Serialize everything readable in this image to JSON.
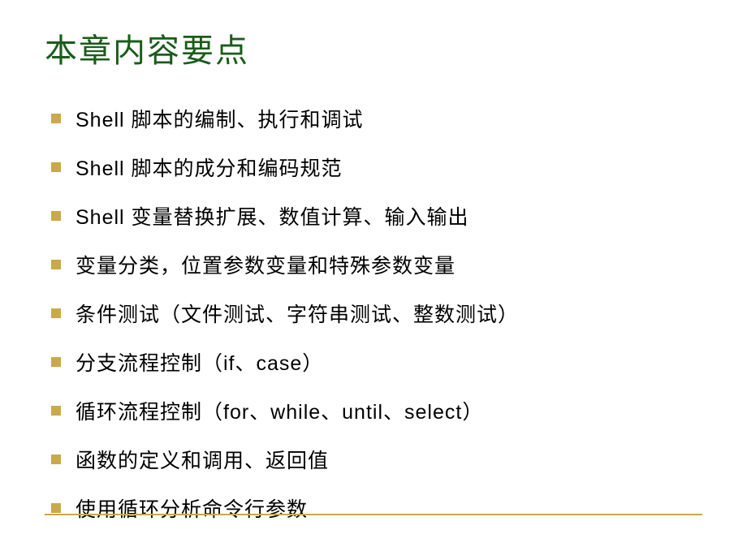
{
  "slide": {
    "title": "本章内容要点",
    "bullets": [
      "Shell 脚本的编制、执行和调试",
      "Shell 脚本的成分和编码规范",
      "Shell 变量替换扩展、数值计算、输入输出",
      "变量分类，位置参数变量和特殊参数变量",
      "条件测试（文件测试、字符串测试、整数测试）",
      "分支流程控制（if、case）",
      "循环流程控制（for、while、until、select）",
      "函数的定义和调用、返回值",
      "使用循环分析命令行参数"
    ]
  }
}
